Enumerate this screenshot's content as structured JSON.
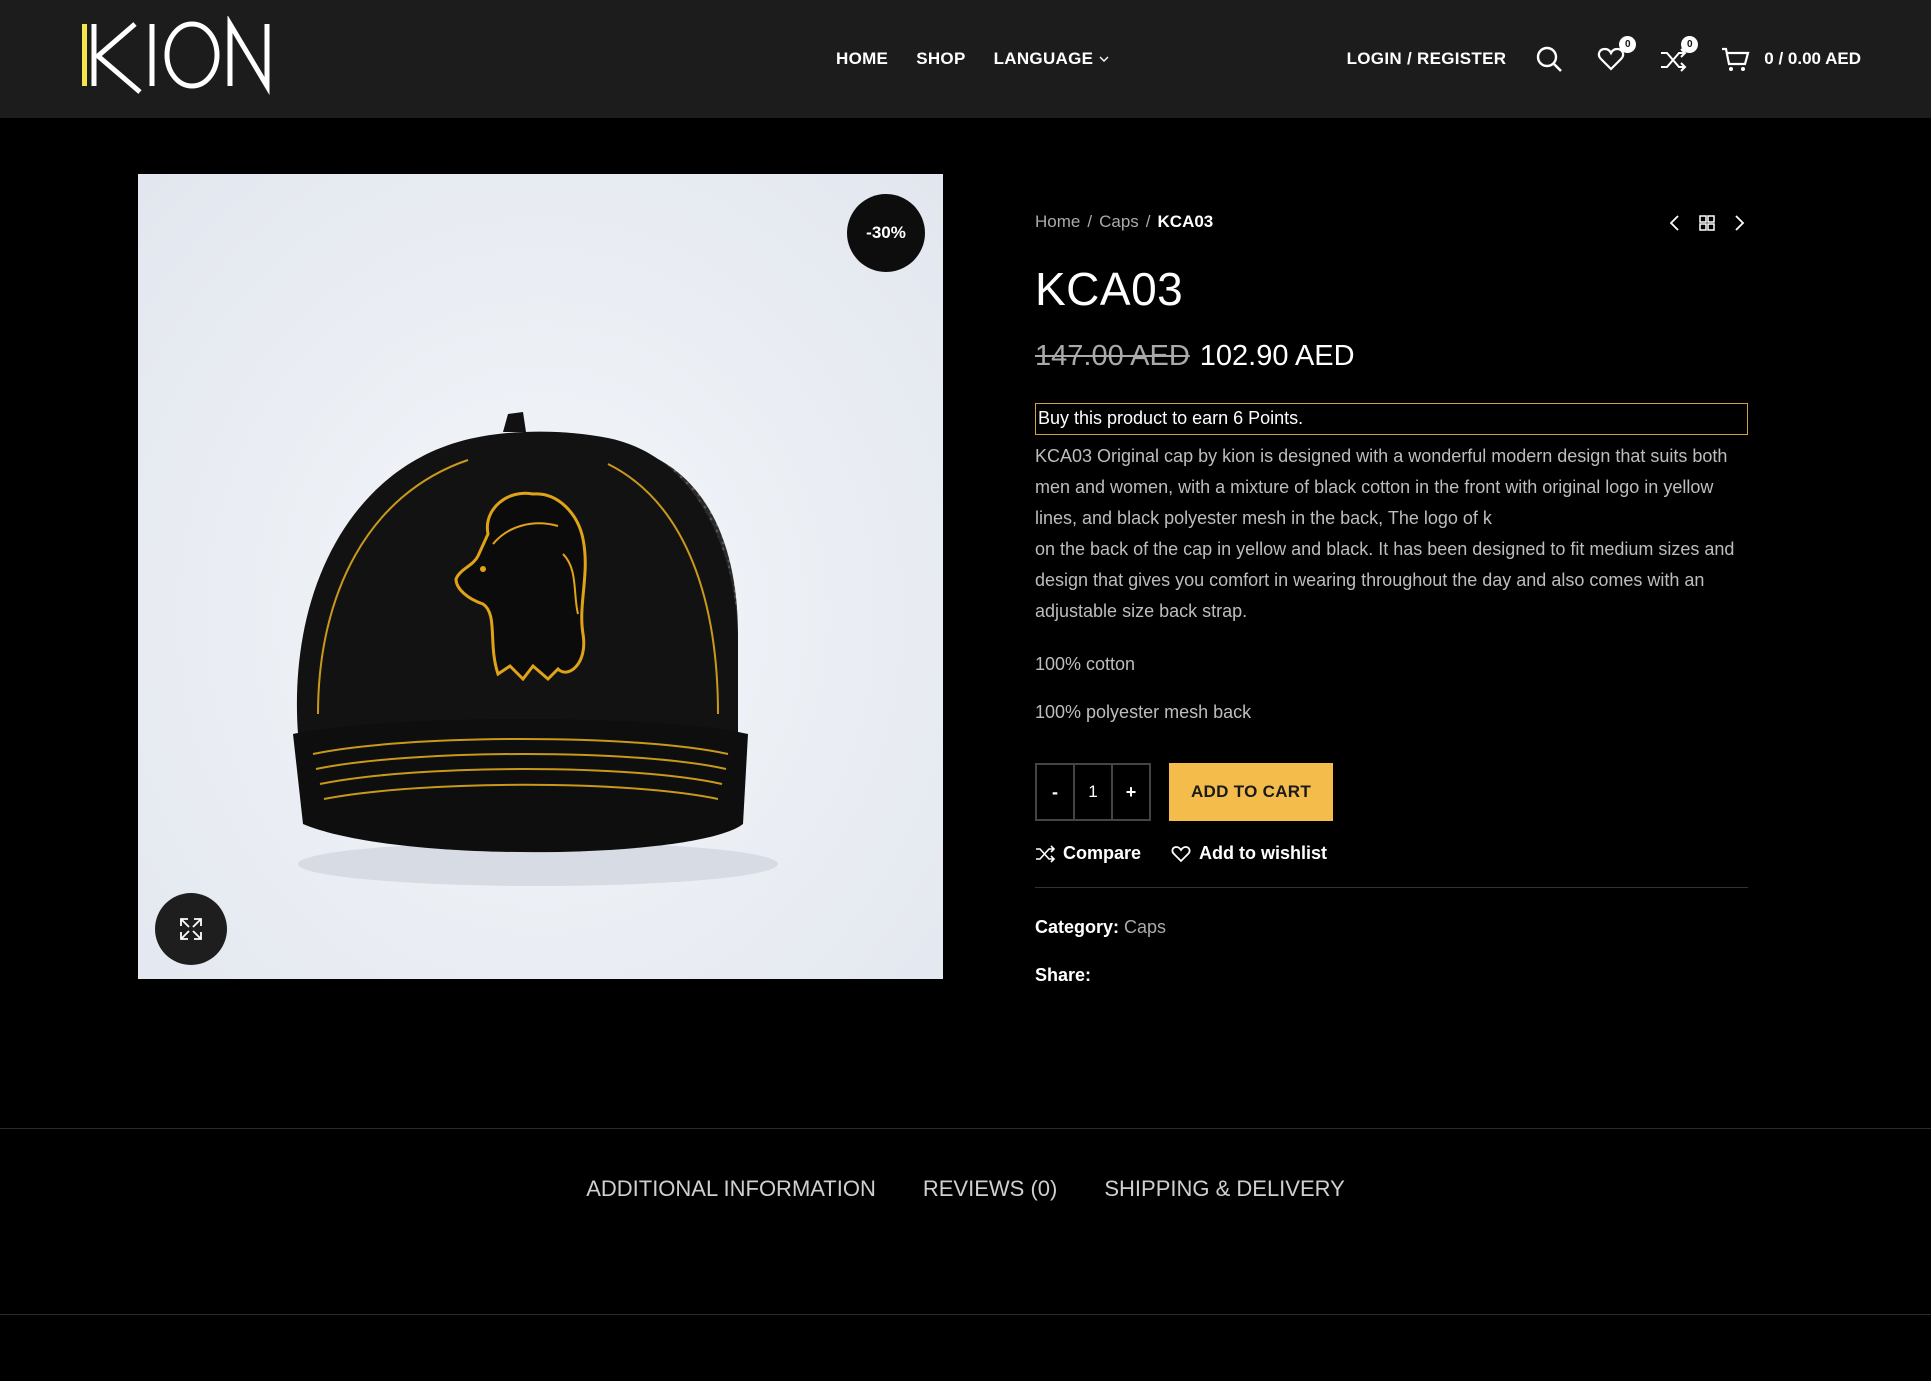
{
  "header": {
    "logo_text": "KION",
    "nav": [
      {
        "label": "HOME"
      },
      {
        "label": "SHOP"
      },
      {
        "label": "LANGUAGE"
      }
    ],
    "login_label": "LOGIN / REGISTER",
    "wishlist_count": "0",
    "compare_count": "0",
    "cart_label": "0 / 0.00 AED"
  },
  "product": {
    "discount_badge": "-30%",
    "breadcrumb": [
      "Home",
      "Caps",
      "KCA03"
    ],
    "title": "KCA03",
    "price_old": "147.00 AED",
    "price_new": "102.90 AED",
    "points_notice": "Buy this product to earn 6 Points.",
    "description": [
      "KCA03 Original cap by kion is designed with a wonderful modern design that suits both",
      "men and women, with a mixture of black cotton in the front with original logo in yellow",
      "lines, and black polyester mesh in the back, The logo of k",
      "on the back of the cap in yellow and black. It has been designed to fit medium sizes and",
      "design that gives you comfort in wearing throughout the day and also comes with an",
      "adjustable size back strap."
    ],
    "material_1": "100% cotton",
    "material_2": "100% polyester mesh back",
    "qty_minus": "-",
    "qty_value": "1",
    "qty_plus": "+",
    "add_to_cart": "ADD TO CART",
    "compare_label": "Compare",
    "wishlist_label": "Add to wishlist",
    "category_key": "Category:",
    "category_value": "Caps",
    "share_label": "Share:",
    "colors": {
      "accent": "#f4bc4a",
      "points_border": "#c9a646",
      "embroidery": "#e0a318"
    }
  },
  "tabs": [
    {
      "label": "ADDITIONAL INFORMATION"
    },
    {
      "label": "REVIEWS (0)"
    },
    {
      "label": "SHIPPING & DELIVERY"
    }
  ]
}
